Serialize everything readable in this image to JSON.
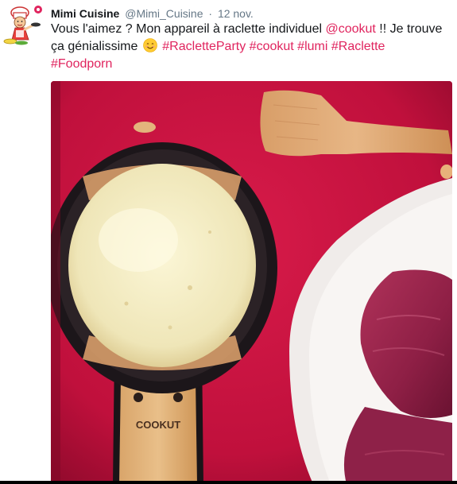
{
  "tweet": {
    "display_name": "Mimi Cuisine",
    "handle": "@Mimi_Cuisine",
    "separator": "·",
    "timestamp": "12 nov.",
    "text_part1": "Vous l'aimez ? Mon appareil à raclette individuel ",
    "mention": "@cookut",
    "text_part2": " !! Je trouve ça génialissime ",
    "emoji": "smiling-face-emoji",
    "hashtags": [
      "#RacletteParty",
      "#cookut",
      "#lumi",
      "#Raclette",
      "#Foodporn"
    ],
    "media_brand": "COOKUT"
  },
  "colors": {
    "link": "#e0245e",
    "name": "#14171a",
    "meta": "#657786",
    "media_background": "#c8103e"
  }
}
